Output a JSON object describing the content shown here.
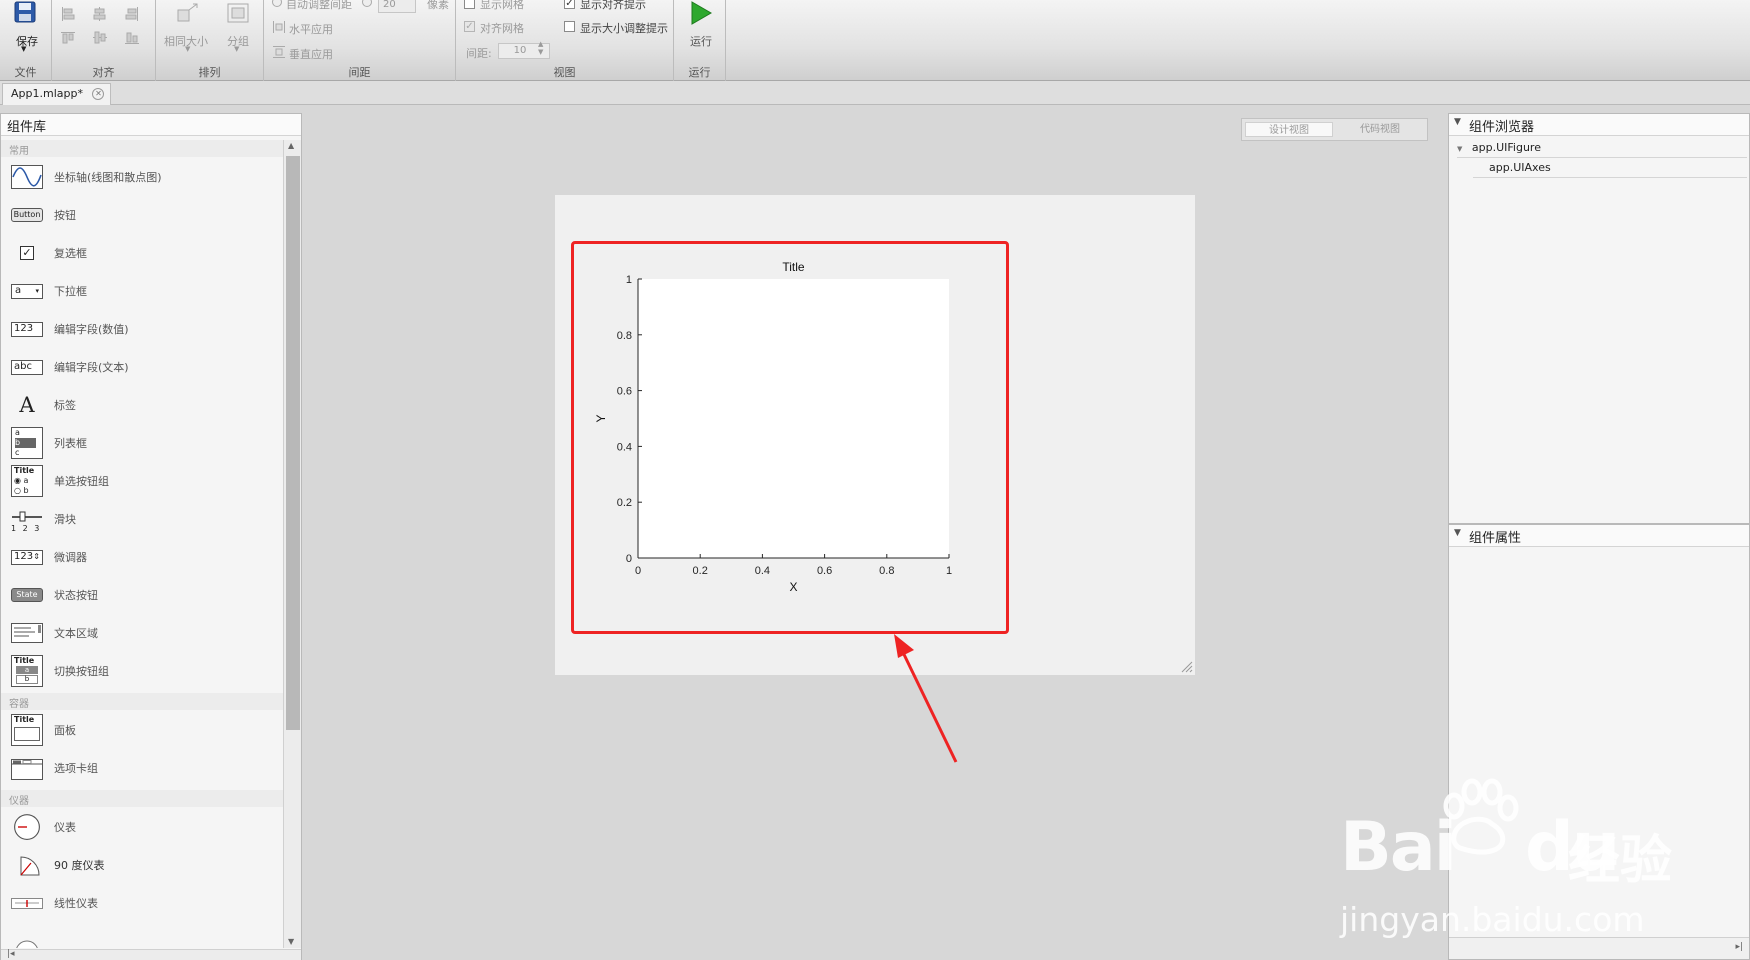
{
  "toolstrip": {
    "file": {
      "save_label": "保存",
      "section_label": "文件"
    },
    "align": {
      "section_label": "对齐"
    },
    "arrange": {
      "same_size_label": "相同大小",
      "group_label": "分组",
      "section_label": "排列"
    },
    "spacing": {
      "auto_spacing_label": "自动调整间距",
      "spacing_value": "20",
      "pixel_unit": "像素",
      "horizontal_label": "水平应用",
      "vertical_label": "垂直应用",
      "section_label": "间距"
    },
    "view": {
      "show_grid_label": "显示网格",
      "snap_grid_label": "对齐网格",
      "interval_label": "间距:",
      "interval_value": "10",
      "show_align_hints_label": "显示对齐提示",
      "show_resize_hints_label": "显示大小调整提示",
      "section_label": "视图"
    },
    "run": {
      "run_label": "运行",
      "section_label": "运行"
    }
  },
  "document_tab": {
    "label": "App1.mlapp*"
  },
  "component_library": {
    "title": "组件库",
    "categories": [
      {
        "label": "常用",
        "items": [
          {
            "icon": "axes-icon",
            "label": "坐标轴(线图和散点图)"
          },
          {
            "icon": "button-icon",
            "label": "按钮",
            "icon_text": "Button"
          },
          {
            "icon": "checkbox-icon",
            "label": "复选框"
          },
          {
            "icon": "dropdown-icon",
            "label": "下拉框",
            "icon_text": "a"
          },
          {
            "icon": "numeric-field-icon",
            "label": "编辑字段(数值)",
            "icon_text": "123"
          },
          {
            "icon": "text-field-icon",
            "label": "编辑字段(文本)",
            "icon_text": "abc"
          },
          {
            "icon": "label-icon",
            "label": "标签",
            "icon_text": "A"
          },
          {
            "icon": "listbox-icon",
            "label": "列表框"
          },
          {
            "icon": "radio-group-icon",
            "label": "单选按钮组"
          },
          {
            "icon": "slider-icon",
            "label": "滑块"
          },
          {
            "icon": "spinner-icon",
            "label": "微调器",
            "icon_text": "123"
          },
          {
            "icon": "state-button-icon",
            "label": "状态按钮",
            "icon_text": "State"
          },
          {
            "icon": "text-area-icon",
            "label": "文本区域"
          },
          {
            "icon": "toggle-group-icon",
            "label": "切换按钮组"
          }
        ]
      },
      {
        "label": "容器",
        "items": [
          {
            "icon": "panel-icon",
            "label": "面板"
          },
          {
            "icon": "tab-group-icon",
            "label": "选项卡组"
          }
        ]
      },
      {
        "label": "仪器",
        "items": [
          {
            "icon": "gauge-icon",
            "label": "仪表"
          },
          {
            "icon": "ninety-gauge-icon",
            "label": "90 度仪表"
          },
          {
            "icon": "linear-gauge-icon",
            "label": "线性仪表"
          }
        ]
      }
    ],
    "icon_texts": {
      "listbox": [
        "a",
        "b",
        "c"
      ],
      "radio": [
        "Title",
        "a",
        "b"
      ],
      "slider_ticks": "1 2 3",
      "toggle": [
        "Title",
        "a",
        "b"
      ],
      "panel": "Title"
    }
  },
  "view_toggle": {
    "design_label": "设计视图",
    "code_label": "代码视图"
  },
  "chart_data": {
    "type": "line",
    "title": "Title",
    "xlabel": "X",
    "ylabel": "Y",
    "xlim": [
      0,
      1
    ],
    "ylim": [
      0,
      1
    ],
    "xticks": [
      "0",
      "0.2",
      "0.4",
      "0.6",
      "0.8",
      "1"
    ],
    "yticks": [
      "0",
      "0.2",
      "0.4",
      "0.6",
      "0.8",
      "1"
    ],
    "series": [],
    "grid": false
  },
  "component_browser": {
    "title": "组件浏览器",
    "tree": [
      {
        "label": "app.UIFigure",
        "level": 0
      },
      {
        "label": "app.UIAxes",
        "level": 1
      }
    ]
  },
  "component_properties": {
    "title": "组件属性"
  },
  "watermark": {
    "brand": "Bai",
    "brand_suffix": "du",
    "chinese": "经验",
    "url": "jingyan.baidu.com"
  },
  "colors": {
    "highlight": "#ee2323",
    "run_green": "#2ea82e"
  }
}
